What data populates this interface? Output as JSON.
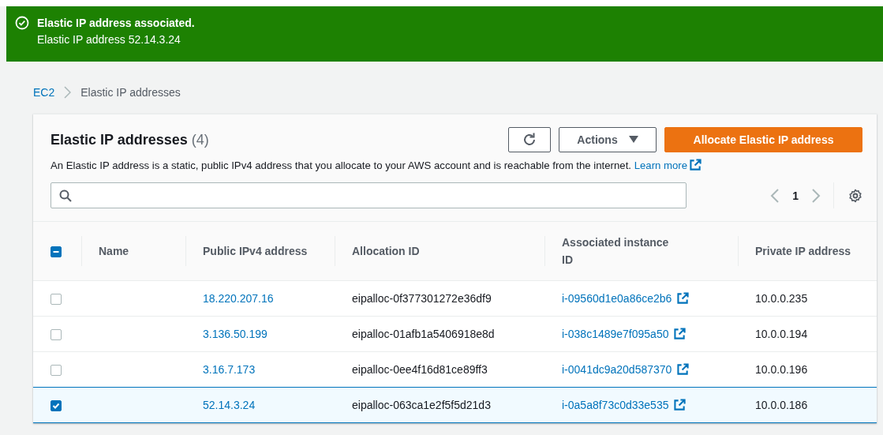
{
  "flash": {
    "title": "Elastic IP address associated.",
    "message": "Elastic IP address 52.14.3.24"
  },
  "breadcrumb": [
    {
      "label": "EC2",
      "link": true
    },
    {
      "label": "Elastic IP addresses",
      "link": false
    }
  ],
  "panel": {
    "title": "Elastic IP addresses",
    "count": "(4)",
    "description": "An Elastic IP address is a static, public IPv4 address that you allocate to your AWS account and is reachable from the internet.",
    "learn_more": "Learn more",
    "actions_button": "Actions",
    "primary_button": "Allocate Elastic IP address"
  },
  "pagination": {
    "page": "1",
    "prev_disabled": true,
    "next_disabled": true
  },
  "table": {
    "select_all": {
      "indeterminate": true
    },
    "columns": [
      "Name",
      "Public IPv4 address",
      "Allocation ID",
      "Associated instance ID",
      "Private IP address"
    ],
    "rows": [
      {
        "selected": false,
        "public_ip": "18.220.207.16",
        "allocation_id": "eipalloc-0f377301272e36df9",
        "instance_id": "i-09560d1e0a86ce2b6",
        "private_ip": "10.0.0.235"
      },
      {
        "selected": false,
        "public_ip": "3.136.50.199",
        "allocation_id": "eipalloc-01afb1a5406918e8d",
        "instance_id": "i-038c1489e7f095a50",
        "private_ip": "10.0.0.194"
      },
      {
        "selected": false,
        "public_ip": "3.16.7.173",
        "allocation_id": "eipalloc-0ee4f16d81ce89ff3",
        "instance_id": "i-0041dc9a20d587370",
        "private_ip": "10.0.0.196"
      },
      {
        "selected": true,
        "public_ip": "52.14.3.24",
        "allocation_id": "eipalloc-063ca1e2f5f5d21d3",
        "instance_id": "i-0a5a8f73c0d33e535",
        "private_ip": "10.0.0.186"
      }
    ]
  }
}
